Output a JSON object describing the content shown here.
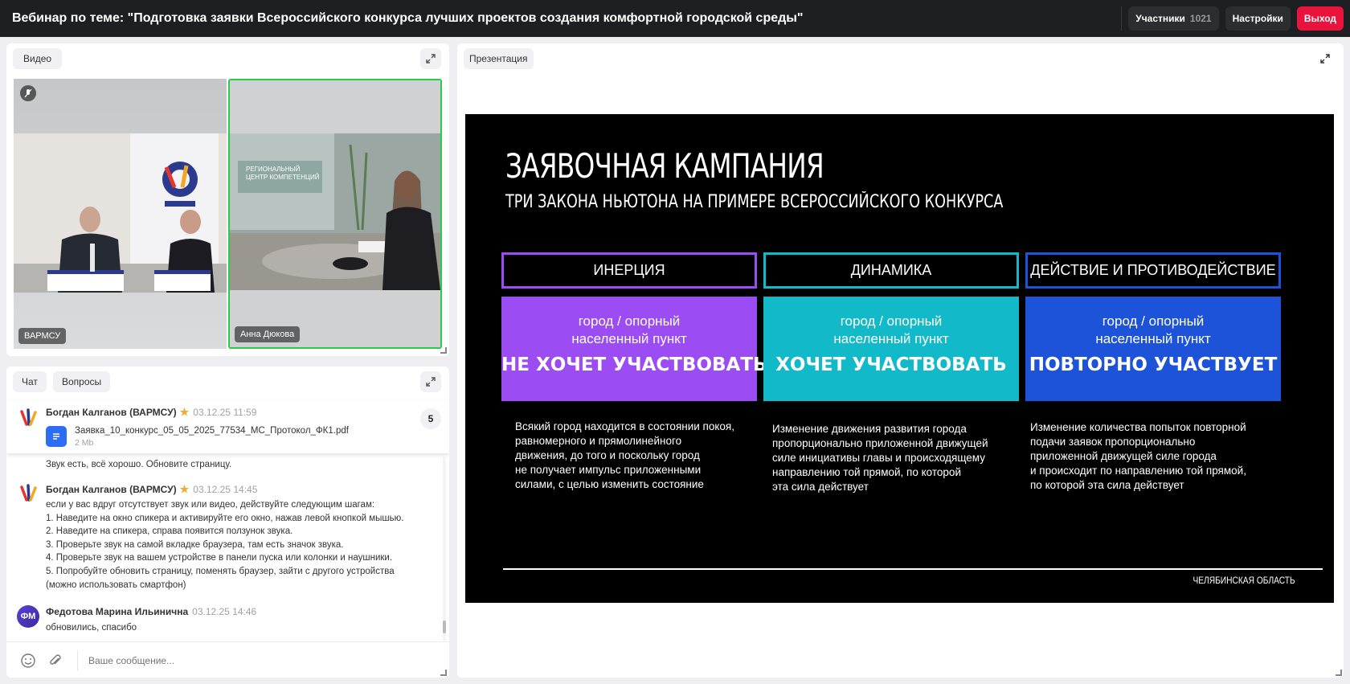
{
  "header": {
    "title": "Вебинар по теме: \"Подготовка заявки Всероссийского конкурса лучших проектов создания комфортной городской среды\"",
    "participants_label": "Участники",
    "participants_count": "1021",
    "settings_label": "Настройки",
    "exit_label": "Выход"
  },
  "video_panel": {
    "tab": "Видео",
    "tiles": [
      {
        "name": "ВАРМСУ",
        "muted": true
      },
      {
        "name": "Анна Дюкова",
        "active": true
      }
    ]
  },
  "chat_panel": {
    "tabs": [
      "Чат",
      "Вопросы"
    ],
    "pinned": {
      "author": "Богдан Калганов (ВАРМСУ)",
      "time": "03.12.25 11:59",
      "file_name": "Заявка_10_конкурс_05_05_2025_77534_МС_Протокол_ФК1.pdf",
      "file_size": "2 Mb",
      "badge": "5"
    },
    "messages": [
      {
        "partial_text": "Звук есть, всё хорошо. Обновите страницу."
      },
      {
        "author": "Богдан Калганов (ВАРМСУ)",
        "time": "03.12.25 14:45",
        "lines": [
          "если у вас вдруг отсутствует звук или видео, действуйте следующим шагам:",
          "1. Наведите на окно спикера и активируйте его окно, нажав левой кнопкой мышью.",
          "2. Наведите на спикера, справа появится ползунок звука.",
          "3. Проверьте звук на самой вкладке браузера, там есть значок звука.",
          "4. Проверьте звук на вашем устройстве в панели пуска или колонки и наушники.",
          "5. Попробуйте обновить страницу, поменять браузер, зайти с другого устройства",
          "(можно использовать смартфон)"
        ]
      },
      {
        "author": "Федотова Марина Ильинична",
        "initials": "ФМ",
        "time": "03.12.25 14:46",
        "lines": [
          "обновились, спасибо"
        ]
      }
    ],
    "input_placeholder": "Ваше сообщение..."
  },
  "presentation_panel": {
    "tab": "Презентация",
    "slide": {
      "title": "ЗАЯВОЧНАЯ КАМПАНИЯ",
      "subtitle": "ТРИ ЗАКОНА НЬЮТОНА НА ПРИМЕРЕ ВСЕРОССИЙСКОГО КОНКУРСА",
      "columns": [
        {
          "header": "ИНЕРЦИЯ",
          "color": "#9b4cf2",
          "small": [
            "город / опорный",
            "населенный пункт"
          ],
          "big": "НЕ ХОЧЕТ УЧАСТВОВАТЬ",
          "desc": [
            "Всякий город находится в состоянии покоя,",
            "равномерного и прямолинейного",
            "движения, до того и поскольку город",
            "не получает импульс приложенными",
            "силами, с целью изменить состояние"
          ]
        },
        {
          "header": "ДИНАМИКА",
          "color": "#12b9c9",
          "small": [
            "город / опорный",
            "населенный пункт"
          ],
          "big": "ХОЧЕТ УЧАСТВОВАТЬ",
          "desc": [
            "Изменение движения развития города",
            "пропорционально приложенной движущей",
            "силе инициативы главы и происходящему",
            "направлению той прямой, по которой",
            "эта сила действует"
          ]
        },
        {
          "header": "ДЕЙСТВИЕ И ПРОТИВОДЕЙСТВИЕ",
          "color": "#1c53d8",
          "small": [
            "город / опорный",
            "населенный пункт"
          ],
          "big": "ПОВТОРНО УЧАСТВУЕТ",
          "desc": [
            "Изменение количества попыток повторной",
            "подачи заявок пропорционально",
            "приложенной движущей силе города",
            "и происходит по направлению той прямой,",
            "по которой эта сила действует"
          ]
        }
      ],
      "region": "ЧЕЛЯБИНСКАЯ ОБЛАСТЬ"
    }
  }
}
